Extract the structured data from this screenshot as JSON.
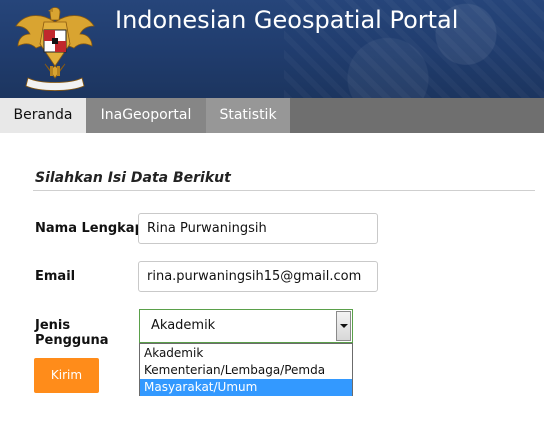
{
  "header": {
    "title": "Indonesian Geospatial Portal",
    "emblem": "garuda-pancasila-emblem",
    "colors": {
      "header_bg": "#233f70",
      "title": "#ffffff"
    }
  },
  "nav": {
    "tabs": [
      {
        "label": "Beranda",
        "active": true
      },
      {
        "label": "InaGeoportal",
        "active": false
      },
      {
        "label": "Statistik",
        "active": false
      }
    ]
  },
  "form": {
    "title": "Silahkan Isi Data Berikut",
    "fields": {
      "nama": {
        "label": "Nama Lengkap",
        "value": "Rina Purwaningsih"
      },
      "email": {
        "label": "Email",
        "value": "rina.purwaningsih15@gmail.com"
      },
      "jenis": {
        "label_line1": "Jenis",
        "label_line2": "Pengguna",
        "selected": "Akademik",
        "options": [
          "Akademik",
          "Kementerian/Lembaga/Pemda",
          "Masyarakat/Umum"
        ],
        "highlighted_option": "Masyarakat/Umum"
      }
    },
    "submit_label": "Kirim",
    "colors": {
      "submit": "#ff8c1a",
      "highlight": "#3399ff",
      "select_border": "#5aa04a"
    }
  }
}
